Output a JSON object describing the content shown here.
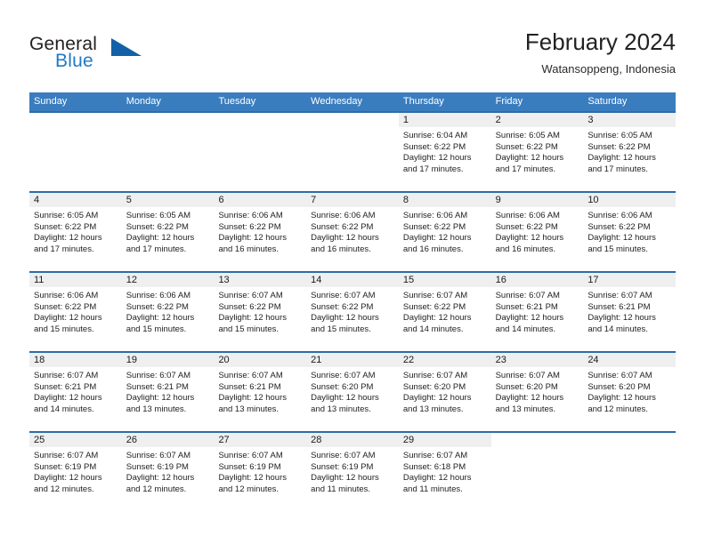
{
  "brand": {
    "name_part1": "General",
    "name_part2": "Blue",
    "triangle_color": "#1261a8",
    "blue_text_color": "#1f7ac4"
  },
  "header": {
    "title": "February 2024",
    "location": "Watansoppeng, Indonesia"
  },
  "theme": {
    "header_blue": "#3a7dbf",
    "row_rule_blue": "#2e6ca4",
    "daynum_band_gray": "#efefef"
  },
  "weekday_headers": [
    "Sunday",
    "Monday",
    "Tuesday",
    "Wednesday",
    "Thursday",
    "Friday",
    "Saturday"
  ],
  "weeks": [
    [
      {
        "day": "",
        "lines": []
      },
      {
        "day": "",
        "lines": []
      },
      {
        "day": "",
        "lines": []
      },
      {
        "day": "",
        "lines": []
      },
      {
        "day": "1",
        "lines": [
          "Sunrise: 6:04 AM",
          "Sunset: 6:22 PM",
          "Daylight: 12 hours",
          "and 17 minutes."
        ]
      },
      {
        "day": "2",
        "lines": [
          "Sunrise: 6:05 AM",
          "Sunset: 6:22 PM",
          "Daylight: 12 hours",
          "and 17 minutes."
        ]
      },
      {
        "day": "3",
        "lines": [
          "Sunrise: 6:05 AM",
          "Sunset: 6:22 PM",
          "Daylight: 12 hours",
          "and 17 minutes."
        ]
      }
    ],
    [
      {
        "day": "4",
        "lines": [
          "Sunrise: 6:05 AM",
          "Sunset: 6:22 PM",
          "Daylight: 12 hours",
          "and 17 minutes."
        ]
      },
      {
        "day": "5",
        "lines": [
          "Sunrise: 6:05 AM",
          "Sunset: 6:22 PM",
          "Daylight: 12 hours",
          "and 17 minutes."
        ]
      },
      {
        "day": "6",
        "lines": [
          "Sunrise: 6:06 AM",
          "Sunset: 6:22 PM",
          "Daylight: 12 hours",
          "and 16 minutes."
        ]
      },
      {
        "day": "7",
        "lines": [
          "Sunrise: 6:06 AM",
          "Sunset: 6:22 PM",
          "Daylight: 12 hours",
          "and 16 minutes."
        ]
      },
      {
        "day": "8",
        "lines": [
          "Sunrise: 6:06 AM",
          "Sunset: 6:22 PM",
          "Daylight: 12 hours",
          "and 16 minutes."
        ]
      },
      {
        "day": "9",
        "lines": [
          "Sunrise: 6:06 AM",
          "Sunset: 6:22 PM",
          "Daylight: 12 hours",
          "and 16 minutes."
        ]
      },
      {
        "day": "10",
        "lines": [
          "Sunrise: 6:06 AM",
          "Sunset: 6:22 PM",
          "Daylight: 12 hours",
          "and 15 minutes."
        ]
      }
    ],
    [
      {
        "day": "11",
        "lines": [
          "Sunrise: 6:06 AM",
          "Sunset: 6:22 PM",
          "Daylight: 12 hours",
          "and 15 minutes."
        ]
      },
      {
        "day": "12",
        "lines": [
          "Sunrise: 6:06 AM",
          "Sunset: 6:22 PM",
          "Daylight: 12 hours",
          "and 15 minutes."
        ]
      },
      {
        "day": "13",
        "lines": [
          "Sunrise: 6:07 AM",
          "Sunset: 6:22 PM",
          "Daylight: 12 hours",
          "and 15 minutes."
        ]
      },
      {
        "day": "14",
        "lines": [
          "Sunrise: 6:07 AM",
          "Sunset: 6:22 PM",
          "Daylight: 12 hours",
          "and 15 minutes."
        ]
      },
      {
        "day": "15",
        "lines": [
          "Sunrise: 6:07 AM",
          "Sunset: 6:22 PM",
          "Daylight: 12 hours",
          "and 14 minutes."
        ]
      },
      {
        "day": "16",
        "lines": [
          "Sunrise: 6:07 AM",
          "Sunset: 6:21 PM",
          "Daylight: 12 hours",
          "and 14 minutes."
        ]
      },
      {
        "day": "17",
        "lines": [
          "Sunrise: 6:07 AM",
          "Sunset: 6:21 PM",
          "Daylight: 12 hours",
          "and 14 minutes."
        ]
      }
    ],
    [
      {
        "day": "18",
        "lines": [
          "Sunrise: 6:07 AM",
          "Sunset: 6:21 PM",
          "Daylight: 12 hours",
          "and 14 minutes."
        ]
      },
      {
        "day": "19",
        "lines": [
          "Sunrise: 6:07 AM",
          "Sunset: 6:21 PM",
          "Daylight: 12 hours",
          "and 13 minutes."
        ]
      },
      {
        "day": "20",
        "lines": [
          "Sunrise: 6:07 AM",
          "Sunset: 6:21 PM",
          "Daylight: 12 hours",
          "and 13 minutes."
        ]
      },
      {
        "day": "21",
        "lines": [
          "Sunrise: 6:07 AM",
          "Sunset: 6:20 PM",
          "Daylight: 12 hours",
          "and 13 minutes."
        ]
      },
      {
        "day": "22",
        "lines": [
          "Sunrise: 6:07 AM",
          "Sunset: 6:20 PM",
          "Daylight: 12 hours",
          "and 13 minutes."
        ]
      },
      {
        "day": "23",
        "lines": [
          "Sunrise: 6:07 AM",
          "Sunset: 6:20 PM",
          "Daylight: 12 hours",
          "and 13 minutes."
        ]
      },
      {
        "day": "24",
        "lines": [
          "Sunrise: 6:07 AM",
          "Sunset: 6:20 PM",
          "Daylight: 12 hours",
          "and 12 minutes."
        ]
      }
    ],
    [
      {
        "day": "25",
        "lines": [
          "Sunrise: 6:07 AM",
          "Sunset: 6:19 PM",
          "Daylight: 12 hours",
          "and 12 minutes."
        ]
      },
      {
        "day": "26",
        "lines": [
          "Sunrise: 6:07 AM",
          "Sunset: 6:19 PM",
          "Daylight: 12 hours",
          "and 12 minutes."
        ]
      },
      {
        "day": "27",
        "lines": [
          "Sunrise: 6:07 AM",
          "Sunset: 6:19 PM",
          "Daylight: 12 hours",
          "and 12 minutes."
        ]
      },
      {
        "day": "28",
        "lines": [
          "Sunrise: 6:07 AM",
          "Sunset: 6:19 PM",
          "Daylight: 12 hours",
          "and 11 minutes."
        ]
      },
      {
        "day": "29",
        "lines": [
          "Sunrise: 6:07 AM",
          "Sunset: 6:18 PM",
          "Daylight: 12 hours",
          "and 11 minutes."
        ]
      },
      {
        "day": "",
        "lines": []
      },
      {
        "day": "",
        "lines": []
      }
    ]
  ]
}
